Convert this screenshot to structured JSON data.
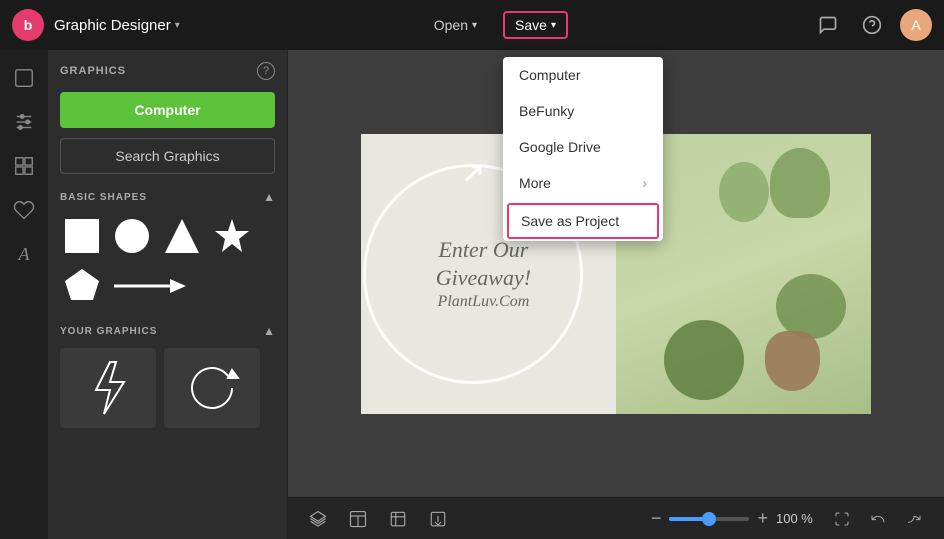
{
  "app": {
    "logo_text": "b",
    "title": "Graphic Designer",
    "title_arrow": "▾"
  },
  "header": {
    "open_label": "Open",
    "open_arrow": "▾",
    "save_label": "Save",
    "save_arrow": "▾",
    "chat_icon": "💬",
    "help_icon": "?",
    "user_initial": "A"
  },
  "save_dropdown": {
    "items": [
      {
        "id": "computer",
        "label": "Computer"
      },
      {
        "id": "befunky",
        "label": "BeFunky"
      },
      {
        "id": "google-drive",
        "label": "Google Drive"
      },
      {
        "id": "more",
        "label": "More",
        "has_arrow": true,
        "arrow": "›"
      },
      {
        "id": "save-as-project",
        "label": "Save as Project",
        "highlighted": true
      }
    ]
  },
  "panel": {
    "title": "GRAPHICS",
    "computer_btn": "Computer",
    "search_btn": "Search Graphics",
    "help_tooltip": "?",
    "sections": [
      {
        "id": "basic-shapes",
        "title": "BASIC SHAPES",
        "expanded": true
      },
      {
        "id": "your-graphics",
        "title": "YOUR GRAPHICS",
        "expanded": true
      }
    ]
  },
  "bottom_toolbar": {
    "zoom_value": "100",
    "zoom_suffix": "%",
    "zoom_percent": "100 %"
  },
  "canvas": {
    "line1": "Enter Our",
    "line2": "Giveaway!",
    "line3": "PlantLuv.Com"
  }
}
